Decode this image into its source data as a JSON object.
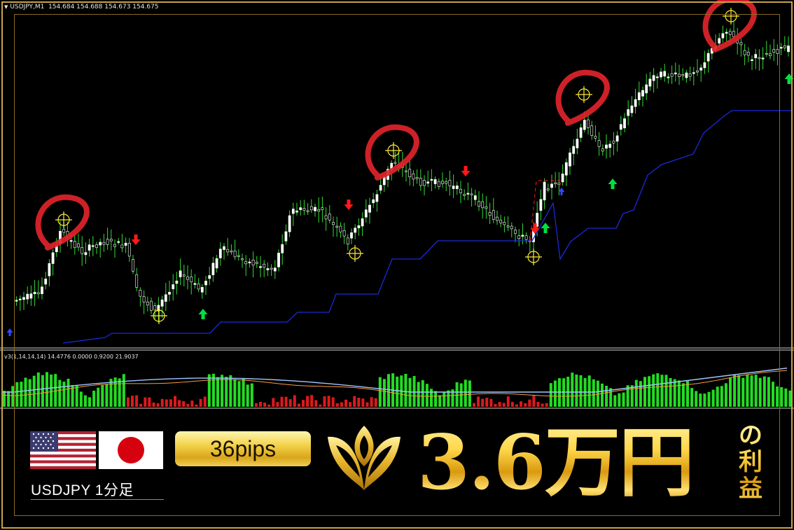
{
  "chart": {
    "symbol_info": "USDJPY,M1  154.684 154.688 154.673 154.675",
    "indicator_info": "v3(1,14,14,14) 14.4776 0.0000 0.9200 21.9037"
  },
  "colors": {
    "background": "#000000",
    "bull_candle": "#ffffff",
    "bear_candle": "#000000",
    "wick": "#33dd33",
    "trail_line": "#1a2ad8",
    "signal_down": "#ff1a1a",
    "signal_up": "#00e040",
    "target_marker": "#ffee33",
    "circle_highlight": "#e0242a",
    "histogram_up": "#22dd22",
    "histogram_down": "#dd1a1a",
    "gold": "#d9a61a"
  },
  "banner": {
    "pair_label": "USDJPY 1分足",
    "pips_label": "36pips",
    "profit_value": "3.6万円",
    "profit_suffix": [
      "の",
      "利",
      "益"
    ]
  },
  "icons": {
    "flag_us": "us-flag-icon",
    "flag_jp": "japan-flag-icon",
    "logo": "gold-tulip-logo-icon"
  }
}
